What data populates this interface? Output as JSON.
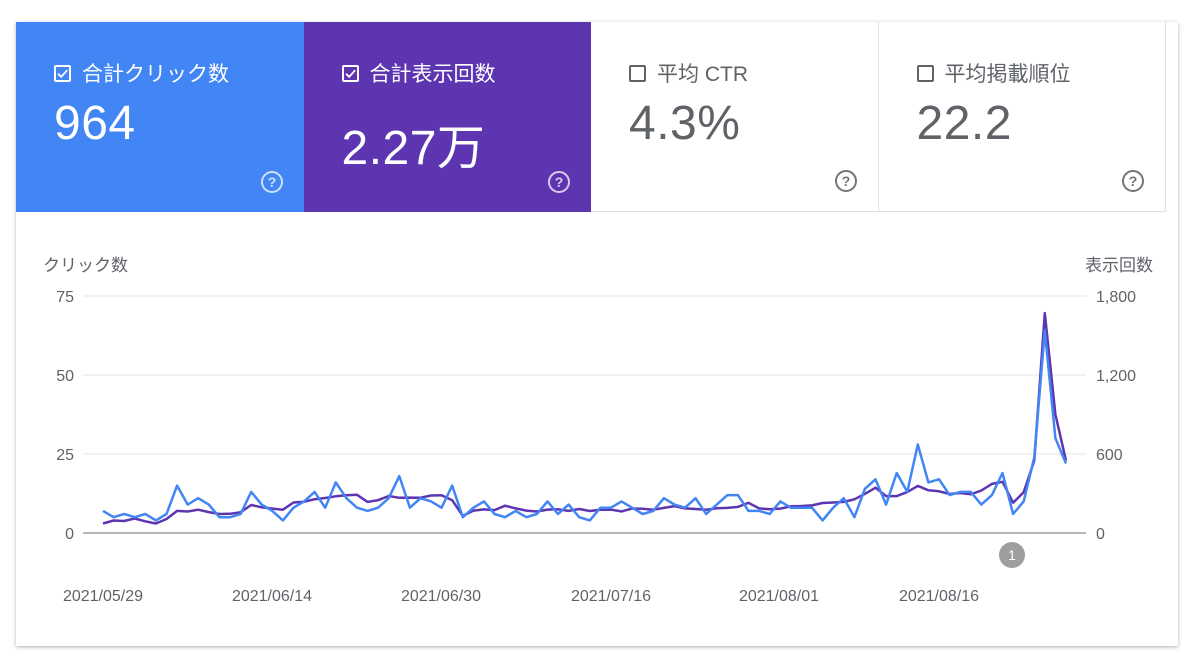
{
  "tiles": [
    {
      "id": "clicks",
      "label": "合計クリック数",
      "value": "964",
      "checked": true,
      "color": "#4285f4"
    },
    {
      "id": "impressions",
      "label": "合計表示回数",
      "value": "2.27万",
      "checked": true,
      "color": "#5e35b1"
    },
    {
      "id": "ctr",
      "label": "平均 CTR",
      "value": "4.3%",
      "checked": false,
      "color": "#ffffff"
    },
    {
      "id": "position",
      "label": "平均掲載順位",
      "value": "22.2",
      "checked": false,
      "color": "#ffffff"
    }
  ],
  "chart": {
    "left_axis_title": "クリック数",
    "right_axis_title": "表示回数",
    "annotation_label": "1"
  },
  "chart_data": {
    "type": "line",
    "title": "",
    "xlabel": "",
    "ylabel": "クリック数",
    "y2label": "表示回数",
    "ylim": [
      0,
      75
    ],
    "y2lim": [
      0,
      1800
    ],
    "y_ticks": [
      "0",
      "25",
      "50",
      "75"
    ],
    "y2_ticks": [
      "0",
      "600",
      "1,200",
      "1,800"
    ],
    "x_ticks": [
      "2021/05/29",
      "2021/06/14",
      "2021/06/30",
      "2021/07/16",
      "2021/08/01",
      "2021/08/16"
    ],
    "x_start": "2021/05/29",
    "annotation": {
      "label": "1",
      "date": "2021/08/24"
    },
    "series": [
      {
        "name": "クリック数",
        "axis": "left",
        "color": "#4285f4",
        "values": [
          7,
          5,
          6,
          5,
          6,
          4,
          6,
          15,
          9,
          11,
          9,
          5,
          5,
          6,
          13,
          9,
          7,
          4,
          8,
          10,
          13,
          8,
          16,
          11,
          8,
          7,
          8,
          11,
          18,
          8,
          11,
          10,
          8,
          15,
          5,
          8,
          10,
          6,
          5,
          7,
          5,
          6,
          10,
          6,
          9,
          5,
          4,
          8,
          8,
          10,
          8,
          6,
          7,
          11,
          9,
          8,
          11,
          6,
          9,
          12,
          12,
          7,
          7,
          6,
          10,
          8,
          8,
          8,
          4,
          8,
          11,
          5,
          14,
          17,
          9,
          19,
          13,
          28,
          16,
          17,
          12,
          13,
          13,
          9,
          12,
          19,
          6,
          10,
          24,
          64,
          30,
          22
        ]
      },
      {
        "name": "表示回数",
        "axis": "right",
        "color": "#5e35b1",
        "values": [
          72,
          95,
          91,
          110,
          89,
          72,
          106,
          168,
          163,
          177,
          159,
          144,
          146,
          158,
          213,
          195,
          185,
          177,
          232,
          237,
          257,
          266,
          279,
          286,
          290,
          236,
          249,
          281,
          267,
          269,
          268,
          285,
          287,
          249,
          130,
          170,
          179,
          174,
          207,
          187,
          170,
          163,
          178,
          180,
          168,
          182,
          167,
          177,
          177,
          164,
          185,
          184,
          177,
          191,
          204,
          187,
          182,
          177,
          188,
          191,
          198,
          229,
          187,
          180,
          185,
          203,
          205,
          210,
          228,
          232,
          236,
          256,
          297,
          344,
          280,
          280,
          311,
          358,
          324,
          317,
          296,
          304,
          294,
          323,
          373,
          389,
          230,
          310,
          550,
          1670,
          900,
          550
        ]
      }
    ]
  }
}
